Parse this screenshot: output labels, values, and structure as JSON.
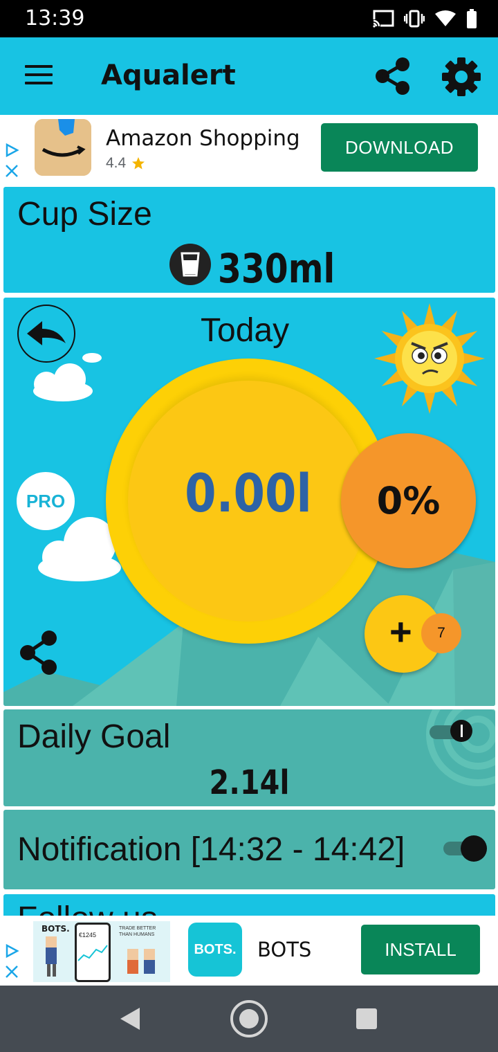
{
  "status_bar": {
    "time": "13:39"
  },
  "app_bar": {
    "title": "Aqualert"
  },
  "ad_top": {
    "app_name": "Amazon Shopping",
    "rating": "4.4",
    "button_label": "DOWNLOAD"
  },
  "cup_size": {
    "label": "Cup Size",
    "value": "330ml"
  },
  "today": {
    "label": "Today",
    "pro_label": "PRO",
    "amount": "0.00l",
    "percent": "0%",
    "badge_count": "7"
  },
  "daily_goal": {
    "label": "Daily Goal",
    "value": "2.14l",
    "toggle_on": true
  },
  "notification": {
    "label": "Notification [14:32 - 14:42]",
    "toggle_on": true
  },
  "follow": {
    "label": "Follow us"
  },
  "ad_bottom": {
    "promo_brand": "BOTS.",
    "promo_tagline": "TRADE BETTER THAN HUMANS",
    "promo_balance": "€1245",
    "app_icon_text": "BOTS.",
    "app_name": "BOTS",
    "button_label": "INSTALL"
  },
  "colors": {
    "app_bar": "#18c3e3",
    "card_blue": "#18c3e3",
    "card_teal": "#4bb3ab",
    "sun_yellow": "#fcc714",
    "percent_orange": "#f5962a",
    "amount_blue": "#2d63a6",
    "ad_button_green": "#098658",
    "nav_bar": "#454b52"
  }
}
